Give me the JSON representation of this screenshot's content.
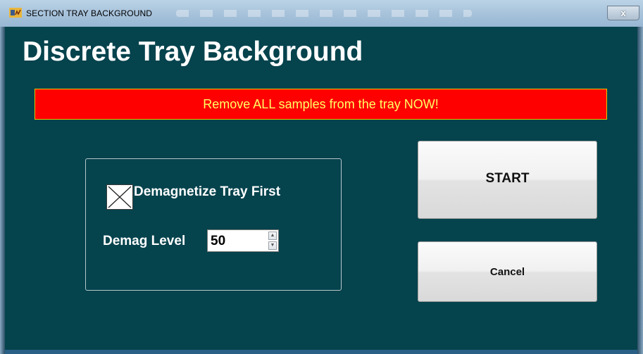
{
  "window": {
    "title": "SECTION TRAY BACKGROUND",
    "close_label": "x"
  },
  "main": {
    "heading": "Discrete Tray Background",
    "warning": "Remove ALL samples from the tray NOW!",
    "options": {
      "demagnetize_label": "Demagnetize Tray First",
      "demagnetize_checked": true,
      "demag_level_label": "Demag Level",
      "demag_level_value": "50"
    },
    "buttons": {
      "start": "START",
      "cancel": "Cancel"
    }
  },
  "colors": {
    "client_bg": "#05434d",
    "warning_bg": "#ff0000",
    "warning_text": "#ffff66"
  },
  "icons": {
    "app": "labview-app-icon",
    "checkbox_mark": "x-cross-icon",
    "spin_up": "up-arrow-icon",
    "spin_down": "down-arrow-icon"
  }
}
